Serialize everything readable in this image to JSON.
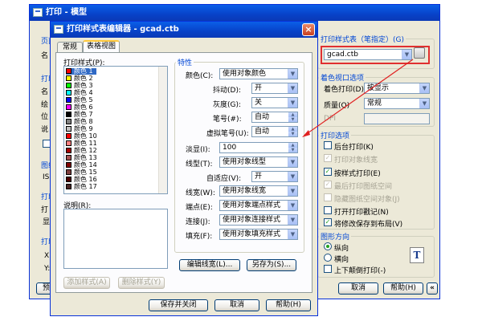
{
  "back_window": {
    "title": "打印 - 模型",
    "left_labels": [
      "页面",
      "名",
      "打印",
      "名",
      "绘",
      "位",
      "说",
      "图纸",
      "IS",
      "打印",
      "打",
      "显",
      "打印",
      "X:",
      "Y:"
    ],
    "preview_label": "预览",
    "plot_style_group": "打印样式表（笔指定）(G)",
    "plot_style_value": "gcad.ctb",
    "shade_group": "着色视口选项",
    "shade_plot_label": "着色打印(D)",
    "shade_plot_value": "按显示",
    "quality_label": "质量(Q)",
    "quality_value": "常规",
    "dpi_label": "DPI",
    "options_group": "打印选项",
    "options": [
      {
        "label": "后台打印(K)",
        "checked": false,
        "disabled": false
      },
      {
        "label": "打印对象线宽",
        "checked": true,
        "disabled": true
      },
      {
        "label": "按样式打印(E)",
        "checked": true,
        "disabled": false
      },
      {
        "label": "最后打印图纸空间",
        "checked": true,
        "disabled": true
      },
      {
        "label": "隐藏图纸空间对象(J)",
        "checked": false,
        "disabled": true
      },
      {
        "label": "打开打印戳记(N)",
        "checked": false,
        "disabled": false
      },
      {
        "label": "将修改保存到布局(V)",
        "checked": true,
        "disabled": false
      }
    ],
    "orientation_group": "图形方向",
    "portrait": "纵向",
    "landscape": "横向",
    "upside_down": "上下颠倒打印(-)",
    "cancel": "取消",
    "help": "帮助(H)",
    "collapse": "«"
  },
  "editor": {
    "title": "打印样式表编辑器 - gcad.ctb",
    "close_glyph": "×",
    "tabs": [
      "常规",
      "表格视图"
    ],
    "styles_label": "打印样式(P):",
    "styles": [
      {
        "name": "颜色 1",
        "color": "#ff0000"
      },
      {
        "name": "颜色 2",
        "color": "#ffff00"
      },
      {
        "name": "颜色 3",
        "color": "#00ff00"
      },
      {
        "name": "颜色 4",
        "color": "#00ffff"
      },
      {
        "name": "颜色 5",
        "color": "#0000ff"
      },
      {
        "name": "颜色 6",
        "color": "#ff00ff"
      },
      {
        "name": "颜色 7",
        "color": "#000000"
      },
      {
        "name": "颜色 8",
        "color": "#808080"
      },
      {
        "name": "颜色 9",
        "color": "#c0c0c0"
      },
      {
        "name": "颜色 10",
        "color": "#ff0000"
      },
      {
        "name": "颜色 11",
        "color": "#ff7f7f"
      },
      {
        "name": "颜色 12",
        "color": "#a50000"
      },
      {
        "name": "颜色 13",
        "color": "#a55252"
      },
      {
        "name": "颜色 14",
        "color": "#7f0000"
      },
      {
        "name": "颜色 15",
        "color": "#7f3f3f"
      },
      {
        "name": "颜色 16",
        "color": "#4c0000"
      },
      {
        "name": "颜色 17",
        "color": "#4c2626"
      }
    ],
    "desc_label": "说明(R):",
    "add_style": "添加样式(A)",
    "delete_style": "删除样式(Y)",
    "props_group": "特性",
    "props": {
      "color_label": "颜色(C):",
      "color_value": "使用对象颜色",
      "dither_label": "抖动(D):",
      "dither_value": "开",
      "gray_label": "灰度(G):",
      "gray_value": "关",
      "pen_label": "笔号(#):",
      "pen_value": "自动",
      "vpen_label": "虚拟笔号(U):",
      "vpen_value": "自动",
      "screen_label": "淡显(I):",
      "screen_value": "100",
      "linetype_label": "线型(T):",
      "linetype_value": "使用对象线型",
      "adaptive_label": "自适应(V):",
      "adaptive_value": "开",
      "lineweight_label": "线宽(W):",
      "lineweight_value": "使用对象线宽",
      "endstyle_label": "端点(E):",
      "endstyle_value": "使用对象端点样式",
      "joinstyle_label": "连接(J):",
      "joinstyle_value": "使用对象连接样式",
      "fill_label": "填充(F):",
      "fill_value": "使用对象填充样式"
    },
    "edit_lw": "编辑线宽(L)...",
    "save_as": "另存为(S)...",
    "save_close": "保存并关闭",
    "cancel": "取消",
    "help": "帮助(H)"
  }
}
